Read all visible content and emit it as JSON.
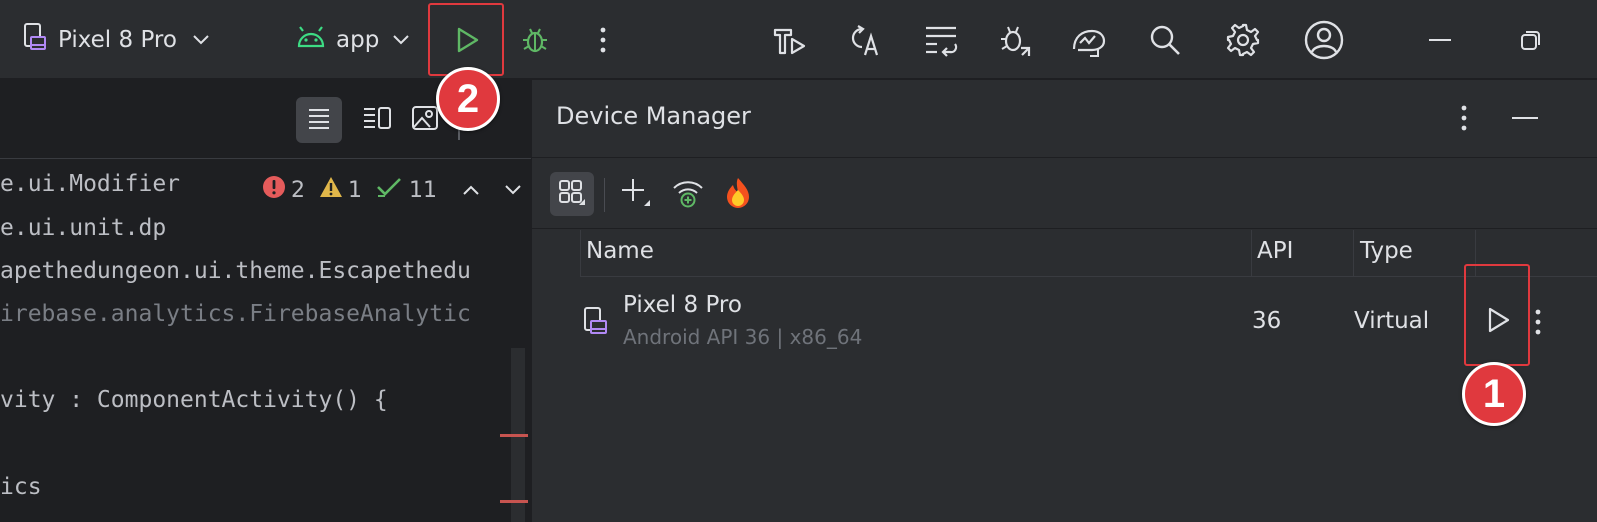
{
  "toolbar": {
    "device_selector": {
      "label": "Pixel 8 Pro"
    },
    "run_config": {
      "label": "app"
    }
  },
  "editor": {
    "code_lines": [
      {
        "text": "e.ui.Modifier",
        "dim": false
      },
      {
        "text": "e.ui.unit.dp",
        "dim": false
      },
      {
        "text": "apethedungeon.ui.theme.Escapethedu",
        "dim": false
      },
      {
        "text": "irebase.analytics.FirebaseAnalytic",
        "dim": true
      },
      {
        "text": "vity : ComponentActivity() {",
        "dim": false
      },
      {
        "text": "ics",
        "dim": false
      }
    ],
    "inspections": {
      "errors": "2",
      "warnings": "1",
      "ok": "11"
    }
  },
  "device_manager": {
    "title": "Device Manager",
    "columns": {
      "name": "Name",
      "api": "API",
      "type": "Type"
    },
    "devices": [
      {
        "name": "Pixel 8 Pro",
        "subtitle": "Android API 36 | x86_64",
        "api": "36",
        "type": "Virtual"
      }
    ]
  },
  "annotations": {
    "callout_1": "1",
    "callout_2": "2",
    "color": "#e0393e"
  },
  "colors": {
    "run_green": "#5fb865",
    "android_green": "#3ddc84",
    "device_purple": "#b189f5"
  },
  "icons": [
    "device-icon",
    "chevron-down-icon",
    "android-icon",
    "run-icon",
    "debug-icon",
    "more-vert-icon",
    "build-icon",
    "translate-icon",
    "sync-icon",
    "profiler-icon",
    "device-mirror-icon",
    "search-icon",
    "gear-icon",
    "account-icon",
    "minimize-icon",
    "restore-icon",
    "code-view-icon",
    "split-view-icon",
    "design-view-icon",
    "error-icon",
    "warning-icon",
    "check-icon",
    "chevron-up-icon",
    "grid-view-icon",
    "add-icon",
    "wifi-pair-icon",
    "firebase-icon"
  ]
}
